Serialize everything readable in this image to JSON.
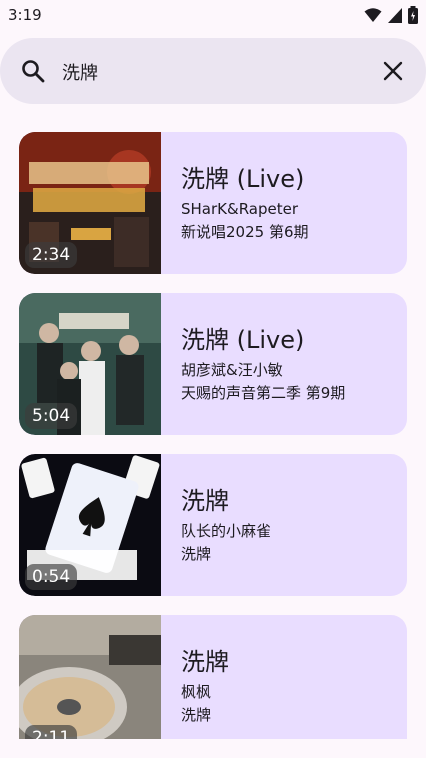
{
  "status": {
    "time": "3:19",
    "icons": [
      "wifi-icon",
      "signal-icon",
      "battery-icon"
    ]
  },
  "search": {
    "query": "洗牌",
    "icon": "search-icon",
    "clear_icon": "close-icon"
  },
  "results": [
    {
      "title": "洗牌 (Live)",
      "artist": "SHarK&Rapeter",
      "album": "新说唱2025 第6期",
      "duration": "2:34"
    },
    {
      "title": "洗牌 (Live)",
      "artist": "胡彦斌&汪小敏",
      "album": "天赐的声音第二季 第9期",
      "duration": "5:04"
    },
    {
      "title": "洗牌",
      "artist": "队长的小麻雀",
      "album": "洗牌",
      "duration": "0:54"
    },
    {
      "title": "洗牌",
      "artist": "枫枫",
      "album": "洗牌",
      "duration": "2:11"
    }
  ],
  "colors": {
    "background": "#fdf7fc",
    "search_bg": "#ebe5f1",
    "card_bg": "#e9ddff"
  }
}
